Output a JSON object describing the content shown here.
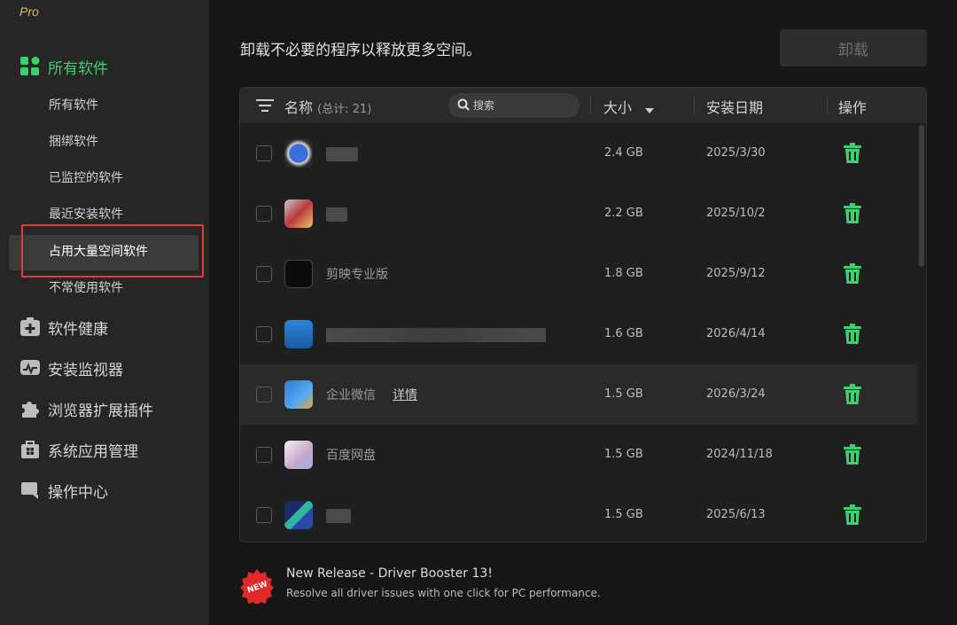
{
  "app": {
    "edition": "Pro"
  },
  "sidebar": {
    "main_active": {
      "label": "所有软件",
      "icon": "grid-icon"
    },
    "sub_items": [
      {
        "label": "所有软件"
      },
      {
        "label": "捆绑软件"
      },
      {
        "label": "已监控的软件"
      },
      {
        "label": "最近安装软件"
      },
      {
        "label": "占用大量空间软件"
      },
      {
        "label": "不常使用软件"
      }
    ],
    "main_items": [
      {
        "label": "软件健康",
        "icon": "first-aid-icon"
      },
      {
        "label": "安装监视器",
        "icon": "monitor-icon"
      },
      {
        "label": "浏览器扩展插件",
        "icon": "puzzle-icon"
      },
      {
        "label": "系统应用管理",
        "icon": "windows-bag-icon"
      },
      {
        "label": "操作中心",
        "icon": "chat-icon"
      }
    ]
  },
  "main": {
    "headline": "卸载不必要的程序以释放更多空间。",
    "uninstall_button": "卸载",
    "table": {
      "col_name": "名称",
      "col_name_count": "(总计: 21)",
      "search_placeholder": "搜索",
      "col_size": "大小",
      "col_date": "安装日期",
      "col_action": "操作",
      "rows": [
        {
          "size": "2.4 GB",
          "date": "2025/3/30",
          "name": ""
        },
        {
          "size": "2.2 GB",
          "date": "2025/10/2",
          "name": ""
        },
        {
          "size": "1.8 GB",
          "date": "2025/9/12",
          "name": "剪映专业版"
        },
        {
          "size": "1.6 GB",
          "date": "2026/4/14",
          "name": ""
        },
        {
          "size": "1.5 GB",
          "date": "2026/3/24",
          "name": "企业微信",
          "link": "详情"
        },
        {
          "size": "1.5 GB",
          "date": "2024/11/18",
          "name": "百度网盘"
        },
        {
          "size": "1.5 GB",
          "date": "2025/6/13",
          "name": ""
        }
      ]
    }
  },
  "promo": {
    "badge": "NEW",
    "title": "New Release - Driver Booster 13!",
    "subtitle": "Resolve all driver issues with one click for PC performance."
  },
  "colors": {
    "accent": "#3cd070",
    "highlight_box": "#e23b3b"
  }
}
